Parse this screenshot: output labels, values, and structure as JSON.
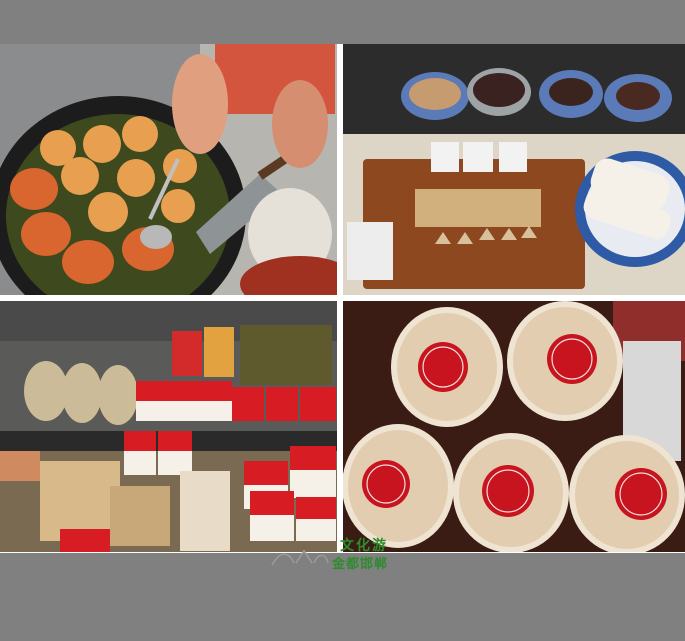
{
  "photos": [
    {
      "id": "frying-cakes",
      "icon": "frying-pan-photo"
    },
    {
      "id": "cutting-board-cakes",
      "icon": "cutting-board-photo"
    },
    {
      "id": "packaged-snacks-stall",
      "icon": "market-stall-photo"
    },
    {
      "id": "round-pastry-boxes",
      "icon": "pastry-box-photo"
    }
  ],
  "watermark": {
    "line1": "文化游",
    "line2": "金都邯郸"
  },
  "colors": {
    "background": "#808080",
    "frame": "#ffffff",
    "watermark_green": "#2e8b2e",
    "box_label_red": "#c8141e"
  }
}
